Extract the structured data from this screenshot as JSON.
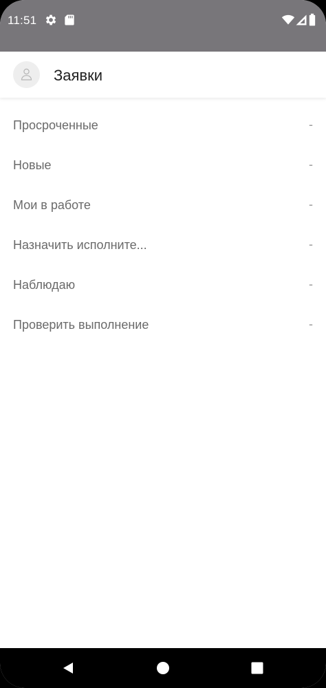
{
  "status_bar": {
    "time": "11:51",
    "icons": [
      "gear-icon",
      "sd-card-icon",
      "wifi-icon",
      "signal-icon",
      "battery-icon"
    ],
    "background": "#78767a"
  },
  "header": {
    "title": "Заявки",
    "avatar_icon": "user-icon"
  },
  "list": {
    "items": [
      {
        "label": "Просроченные",
        "count": "-"
      },
      {
        "label": "Новые",
        "count": "-"
      },
      {
        "label": "Мои в работе",
        "count": "-"
      },
      {
        "label": "Назначить исполните...",
        "count": "-"
      },
      {
        "label": "Наблюдаю",
        "count": "-"
      },
      {
        "label": "Проверить выполнение",
        "count": "-"
      }
    ]
  },
  "nav_bar": {
    "buttons": [
      "back-icon",
      "home-icon",
      "recents-icon"
    ]
  }
}
